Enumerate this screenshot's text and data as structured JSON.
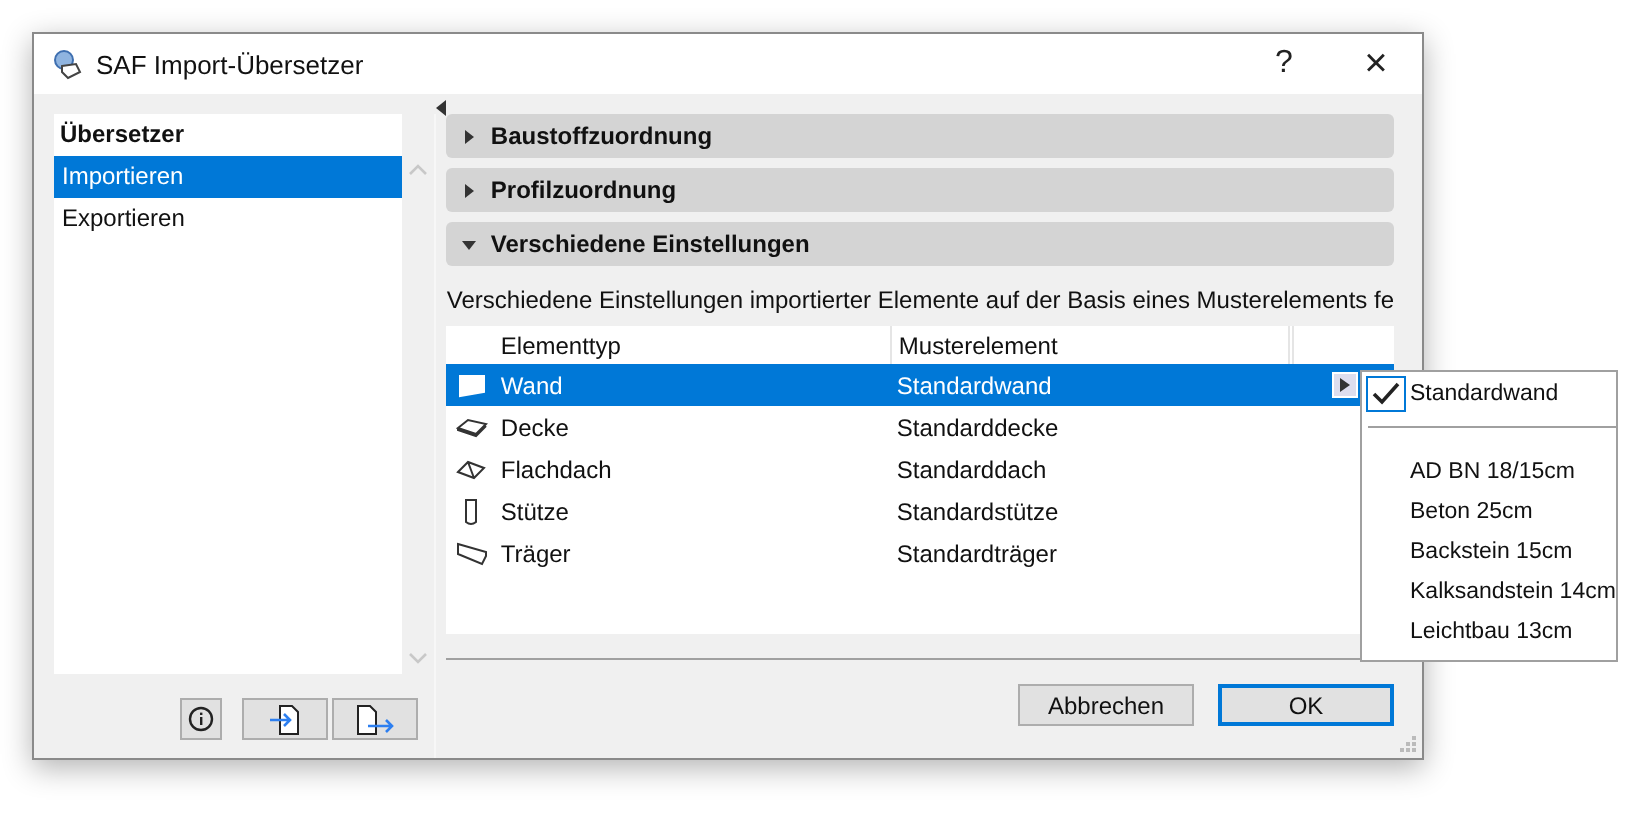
{
  "window": {
    "title": "SAF Import-Übersetzer",
    "help": "?",
    "close": "×"
  },
  "sidebar": {
    "heading": "Übersetzer",
    "items": [
      {
        "label": "Importieren",
        "selected": true
      },
      {
        "label": "Exportieren",
        "selected": false
      }
    ]
  },
  "sections": [
    {
      "label": "Baustoffzuordnung",
      "expanded": false
    },
    {
      "label": "Profilzuordnung",
      "expanded": false
    },
    {
      "label": "Verschiedene Einstellungen",
      "expanded": true
    }
  ],
  "description": "Verschiedene Einstellungen importierter Elemente auf der Basis eines Musterelements fe",
  "table": {
    "columns": [
      "Elementtyp",
      "Musterelement"
    ],
    "rows": [
      {
        "type": "Wand",
        "sample": "Standardwand",
        "selected": true
      },
      {
        "type": "Decke",
        "sample": "Standarddecke",
        "selected": false
      },
      {
        "type": "Flachdach",
        "sample": "Standarddach",
        "selected": false
      },
      {
        "type": "Stütze",
        "sample": "Standardstütze",
        "selected": false
      },
      {
        "type": "Träger",
        "sample": "Standardträger",
        "selected": false
      }
    ]
  },
  "dropdown_menu": {
    "items": [
      {
        "label": "Standardwand",
        "checked": true
      },
      {
        "label": "AD BN 18/15cm",
        "checked": false
      },
      {
        "label": "Beton 25cm",
        "checked": false
      },
      {
        "label": "Backstein 15cm",
        "checked": false
      },
      {
        "label": "Kalksandstein 14cm",
        "checked": false
      },
      {
        "label": "Leichtbau 13cm",
        "checked": false
      }
    ]
  },
  "buttons": [
    {
      "label": "Abbrechen",
      "default": false
    },
    {
      "label": "OK",
      "default": true
    }
  ]
}
